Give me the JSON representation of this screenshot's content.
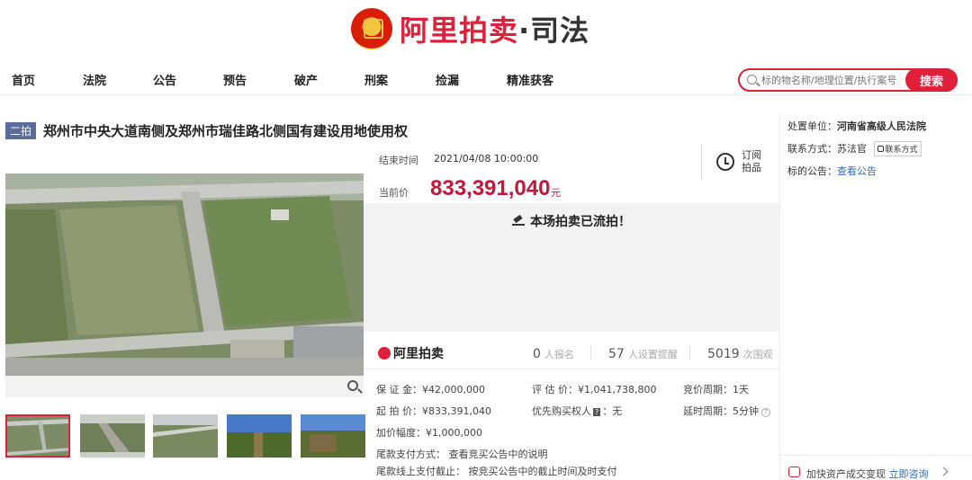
{
  "header": {
    "logo_text": "阿里拍卖",
    "logo_dot": "·",
    "logo_suffix": "司法"
  },
  "nav": {
    "items": [
      "首页",
      "法院",
      "公告",
      "预告",
      "破产",
      "刑案",
      "捡漏",
      "精准获客"
    ]
  },
  "search": {
    "placeholder": "标的物名称/地理位置/执行案号",
    "button_label": "搜索"
  },
  "listing": {
    "round": "二拍",
    "title": "郑州市中央大道南侧及郑州市瑞佳路北侧国有建设用地使用权",
    "end_time_label": "结束时间",
    "end_time": "2021/04/08 10:00:00",
    "price_label": "当前价",
    "current_price": "833,391,040",
    "price_unit": "元",
    "subscribe_label": "订阅拍品",
    "status_message": "本场拍卖已流拍！"
  },
  "stats": {
    "brand": "阿里拍卖",
    "signups": "0",
    "signups_label": "人报名",
    "reminders": "57",
    "reminders_label": "人设置提醒",
    "views": "5019",
    "views_label": "次围观"
  },
  "details": {
    "deposit": "保 证 金：¥42,000,000",
    "appraisal": "评 估 价：¥1,041,738,800",
    "bid_cycle": "竞价周期：1天",
    "start_price": "起 拍 价：¥833,391,040",
    "priority_label": "优先购买权人",
    "priority_value": "：无",
    "delay_cycle": "延时周期：5分钟",
    "increment": "加价幅度：¥1,000,000",
    "tail_payment_method": "尾款支付方式：  查看竞买公告中的说明",
    "tail_payment_deadline": "尾款线上支付截止：  按竞买公告中的截止时间及时支付"
  },
  "sidebar": {
    "court_label": "处置单位：",
    "court": "河南省高级人民法院",
    "contact_label": "联系方式：",
    "contact_name": "苏法官",
    "contact_button": "联系方式",
    "notice_label": "标的公告：",
    "notice_link": "查看公告",
    "bottom_text": "加快资产成交变现",
    "bottom_link": "立即咨询"
  },
  "colors": {
    "brand_red": "#e0203a",
    "price_red": "#c4173a",
    "badge_blue": "#5b6b9a",
    "link_blue": "#2b6cc4"
  }
}
